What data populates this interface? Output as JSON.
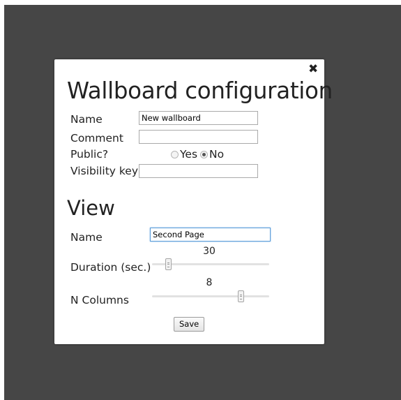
{
  "dialog": {
    "title": "Wallboard configuration",
    "close_icon": "close-icon"
  },
  "wallboard": {
    "name_label": "Name",
    "name_value": "New wallboard",
    "comment_label": "Comment",
    "comment_value": "",
    "public_label": "Public?",
    "public_options": [
      {
        "label": "Yes",
        "checked": false
      },
      {
        "label": "No",
        "checked": true
      }
    ],
    "visibility_label": "Visibility key",
    "visibility_value": ""
  },
  "view": {
    "heading": "View",
    "name_label": "Name",
    "name_value": "Second Page",
    "duration_label": "Duration (sec.)",
    "duration_value": "30",
    "columns_label": "N Columns",
    "columns_value": "8"
  },
  "actions": {
    "save_label": "Save"
  },
  "colors": {
    "backdrop": "#464646",
    "dialog_background": "#ffffff",
    "focus_border": "#5b9dd9"
  }
}
